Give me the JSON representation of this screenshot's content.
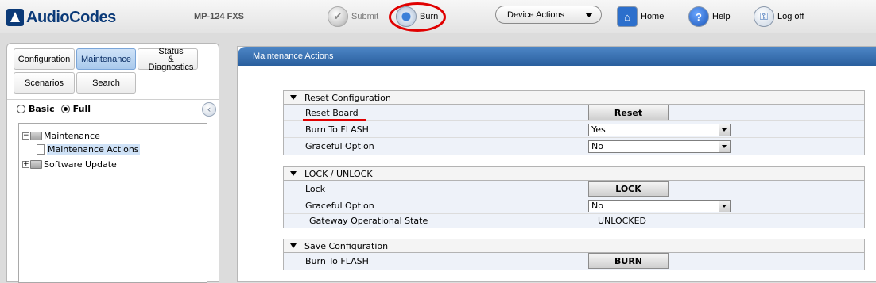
{
  "header": {
    "logo_text": "AudioCodes",
    "device_model": "MP-124 FXS",
    "submit_label": "Submit",
    "burn_label": "Burn",
    "device_actions_label": "Device Actions",
    "home_label": "Home",
    "help_label": "Help",
    "logoff_label": "Log off",
    "help_glyph": "?",
    "highlight_color": "#e00000"
  },
  "nav": {
    "tabs": [
      {
        "label": "Configuration",
        "active": false
      },
      {
        "label": "Maintenance",
        "active": true
      },
      {
        "label": "Status\n& Diagnostics",
        "active": false
      },
      {
        "label": "Scenarios",
        "active": false
      },
      {
        "label": "Search",
        "active": false
      }
    ],
    "view_basic": "Basic",
    "view_full": "Full",
    "view_selected": "Full"
  },
  "tree": {
    "root": {
      "label": "Maintenance",
      "expander": "−"
    },
    "child": {
      "label": "Maintenance Actions",
      "selected": true
    },
    "sibling": {
      "label": "Software Update",
      "expander": "+"
    }
  },
  "main": {
    "title": "Maintenance Actions",
    "reset": {
      "title": "Reset Configuration",
      "reset_board_label": "Reset Board",
      "reset_button": "Reset",
      "burn_flash_label": "Burn To FLASH",
      "burn_flash_value": "Yes",
      "graceful_label": "Graceful Option",
      "graceful_value": "No"
    },
    "lock": {
      "title": "LOCK / UNLOCK",
      "lock_label": "Lock",
      "lock_button": "LOCK",
      "graceful_label": "Graceful Option",
      "graceful_value": "No",
      "state_label": "Gateway Operational State",
      "state_value": "UNLOCKED"
    },
    "save": {
      "title": "Save Configuration",
      "burn_flash_label": "Burn To FLASH",
      "burn_button": "BURN"
    }
  }
}
